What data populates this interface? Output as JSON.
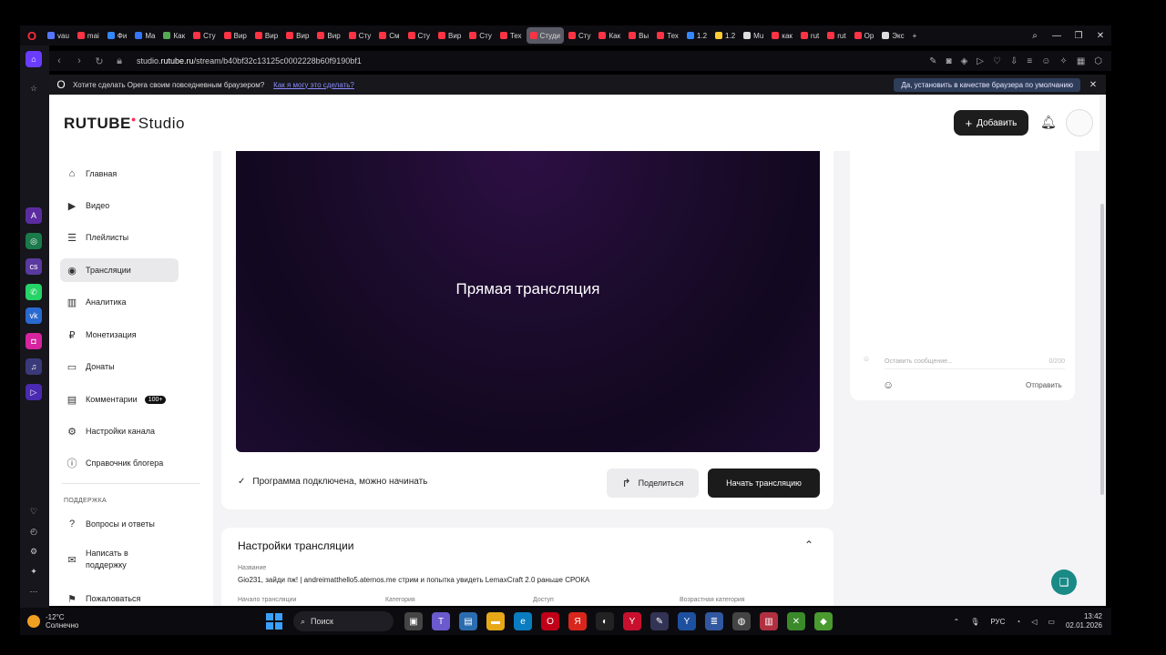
{
  "browser": {
    "tabs": [
      {
        "label": "vau",
        "color": "#5577ff"
      },
      {
        "label": "mai",
        "color": "#ff3344"
      },
      {
        "label": "Фи",
        "color": "#3388ff"
      },
      {
        "label": "Ma",
        "color": "#3377ff"
      },
      {
        "label": "Как",
        "color": "#55aa55"
      },
      {
        "label": "Сту",
        "color": "#ff3344"
      },
      {
        "label": "Вир",
        "color": "#ff3344"
      },
      {
        "label": "Вир",
        "color": "#ff3344"
      },
      {
        "label": "Вир",
        "color": "#ff3344"
      },
      {
        "label": "Вир",
        "color": "#ff3344"
      },
      {
        "label": "Сту",
        "color": "#ff3344"
      },
      {
        "label": "См",
        "color": "#ff3344"
      },
      {
        "label": "Сту",
        "color": "#ff3344"
      },
      {
        "label": "Вир",
        "color": "#ff3344"
      },
      {
        "label": "Сту",
        "color": "#ff3344"
      },
      {
        "label": "Тех",
        "color": "#ff3344"
      },
      {
        "label": "Студи",
        "color": "#ff3344",
        "active": true
      },
      {
        "label": "Сту",
        "color": "#ff3344"
      },
      {
        "label": "Как",
        "color": "#ff3344"
      },
      {
        "label": "Вы",
        "color": "#ff3344"
      },
      {
        "label": "Тех",
        "color": "#ff3344"
      },
      {
        "label": "1.2",
        "color": "#3388ff"
      },
      {
        "label": "1.2",
        "color": "#ffcc33"
      },
      {
        "label": "Mu",
        "color": "#dddddd"
      },
      {
        "label": "как",
        "color": "#ff3344"
      },
      {
        "label": "rut",
        "color": "#ff3344"
      },
      {
        "label": "rut",
        "color": "#ff3344"
      },
      {
        "label": "Op",
        "color": "#ff3344"
      },
      {
        "label": "Экс",
        "color": "#dddddd"
      }
    ],
    "url_prefix": "studio.",
    "url_domain": "rutube.ru",
    "url_path": "/stream/b40bf32c13125c0002228b60f9190bf1",
    "default_prompt": "Хотите сделать Opera своим повседневным браузером?",
    "default_link": "Как я могу это сделать?",
    "default_button": "Да, установить в качестве браузера по умолчанию"
  },
  "header": {
    "logo_rutube": "RUTUBE",
    "logo_studio": "Studio",
    "add_button": "Добавить"
  },
  "sidebar": {
    "items": [
      {
        "label": "Главная",
        "icon": "home-icon",
        "glyph": "⌂"
      },
      {
        "label": "Видео",
        "icon": "video-icon",
        "glyph": "▶"
      },
      {
        "label": "Плейлисты",
        "icon": "playlist-icon",
        "glyph": "☰"
      },
      {
        "label": "Трансляции",
        "icon": "broadcast-icon",
        "glyph": "◉",
        "active": true
      },
      {
        "label": "Аналитика",
        "icon": "analytics-icon",
        "glyph": "▥"
      },
      {
        "label": "Монетизация",
        "icon": "monetization-icon",
        "glyph": "₽"
      },
      {
        "label": "Донаты",
        "icon": "donate-icon",
        "glyph": "▭"
      },
      {
        "label": "Комментарии",
        "icon": "comments-icon",
        "glyph": "▤",
        "badge": "100+"
      },
      {
        "label": "Настройки канала",
        "icon": "settings-icon",
        "glyph": "⚙"
      },
      {
        "label": "Справочник блогера",
        "icon": "info-icon",
        "glyph": "ⓘ"
      }
    ],
    "support_heading": "ПОДДЕРЖКА",
    "support_items": [
      {
        "label": "Вопросы и ответы",
        "icon": "faq-icon",
        "glyph": "?"
      },
      {
        "label": "Написать в поддержку",
        "icon": "mail-icon",
        "glyph": "✉"
      },
      {
        "label": "Пожаловаться",
        "icon": "flag-icon",
        "glyph": "⚑"
      }
    ]
  },
  "stream": {
    "player_title": "Прямая трансляция",
    "status": "Программа подключена, можно начинать",
    "share_button": "Поделиться",
    "start_button": "Начать трансляцию"
  },
  "chat": {
    "placeholder": "Оставить сообщение...",
    "counter": "0/200",
    "send": "Отправить"
  },
  "settings": {
    "title": "Настройки трансляции",
    "name_label": "Название",
    "name_value": "Gio231, зайди пж! | andreimatthello5.aternos.me стрим и попытка увидеть LemaxCraft 2.0 раньше СРОКА",
    "start_label": "Начало трансляции",
    "category_label": "Категория",
    "access_label": "Доступ",
    "age_label": "Возрастная категория"
  },
  "taskbar": {
    "temp": "-12°C",
    "weather": "Солнечно",
    "search": "Поиск",
    "lang": "РУС",
    "time": "13:42",
    "date": "02.01.2026"
  },
  "colors": {
    "accent_dark": "#1b1b1b",
    "player_purple": "#1a0b2a",
    "fab_teal": "#1a8a86"
  }
}
